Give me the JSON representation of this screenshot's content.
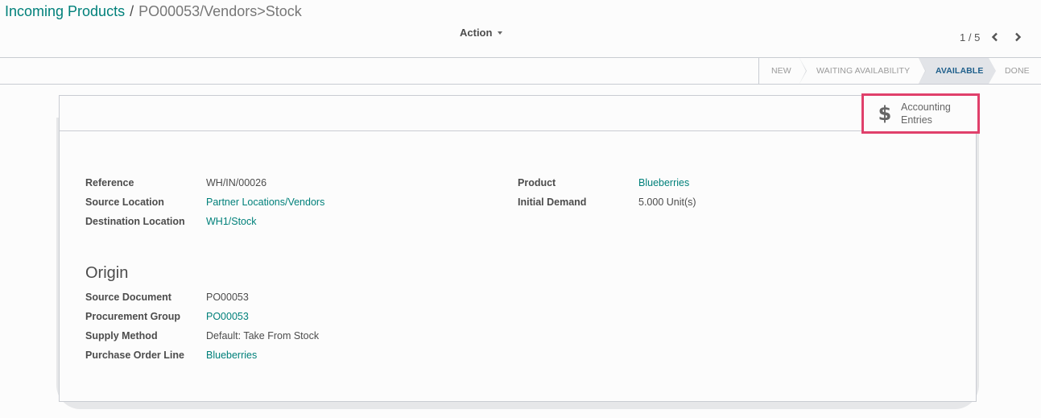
{
  "breadcrumb": {
    "parent": "Incoming Products",
    "separator": "/",
    "current": "PO00053/Vendors>Stock"
  },
  "toolbar": {
    "action_label": "Action"
  },
  "pager": {
    "value": "1 / 5",
    "prev_icon": "chevron-left",
    "next_icon": "chevron-right"
  },
  "statusbar": {
    "stages": [
      {
        "label": "NEW",
        "active": false
      },
      {
        "label": "WAITING AVAILABILITY",
        "active": false
      },
      {
        "label": "AVAILABLE",
        "active": true
      },
      {
        "label": "DONE",
        "active": false
      }
    ]
  },
  "smart_buttons": {
    "accounting": {
      "icon": "dollar-icon",
      "glyph": "$",
      "line1": "Accounting",
      "line2": "Entries",
      "highlight_color": "#e0406b"
    }
  },
  "form": {
    "left_fields": [
      {
        "label": "Reference",
        "value": "WH/IN/00026",
        "link": false
      },
      {
        "label": "Source Location",
        "value": "Partner Locations/Vendors",
        "link": true
      },
      {
        "label": "Destination Location",
        "value": "WH1/Stock",
        "link": true
      }
    ],
    "right_fields": [
      {
        "label": "Product",
        "value": "Blueberries",
        "link": true
      },
      {
        "label": "Initial Demand",
        "value": "5.000 Unit(s)",
        "link": false
      }
    ],
    "origin": {
      "title": "Origin",
      "fields": [
        {
          "label": "Source Document",
          "value": "PO00053",
          "link": false
        },
        {
          "label": "Procurement Group",
          "value": "PO00053",
          "link": true
        },
        {
          "label": "Supply Method",
          "value": "Default: Take From Stock",
          "link": false
        },
        {
          "label": "Purchase Order Line",
          "value": "Blueberries",
          "link": true
        }
      ]
    }
  },
  "colors": {
    "link": "#00807a",
    "active_stage": "#1f5f8b",
    "highlight": "#e0406b"
  }
}
